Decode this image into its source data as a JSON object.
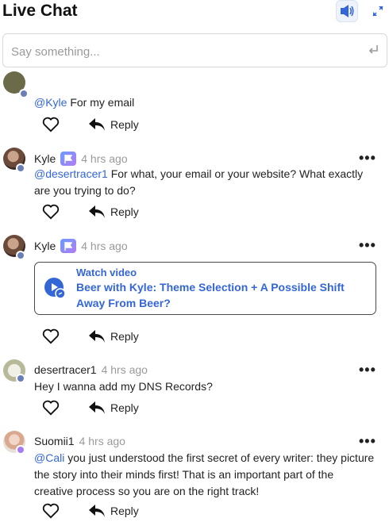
{
  "header": {
    "title": "Live Chat"
  },
  "input": {
    "placeholder": "Say something..."
  },
  "messages": [
    {
      "name": "",
      "time": "",
      "mention": "@Kyle",
      "text": " For my email",
      "reply": "Reply"
    },
    {
      "name": "Kyle",
      "time": "4 hrs ago",
      "mention": "@desertracer1",
      "text": " For what, your email or your website? What exactly are you trying to do?",
      "reply": "Reply"
    },
    {
      "name": "Kyle",
      "time": "4 hrs ago",
      "video_kicker": "Watch video",
      "video_title": "Beer with Kyle: Theme Selection + A Possible Shift Away From Beer?",
      "reply": "Reply"
    },
    {
      "name": "desertracer1",
      "time": "4 hrs ago",
      "text": "Hey I wanna add my DNS Records?",
      "reply": "Reply"
    },
    {
      "name": "Suomii1",
      "time": "4 hrs ago",
      "mention": "@Cali",
      "text": " you just understood the first secret of every writer: they picture the story into their minds first! That is an important part of the creative process so you are on the right track!",
      "reply": "Reply"
    }
  ],
  "colors": {
    "mention": "#3466d6",
    "accent": "#3466d6",
    "timestamp": "#9a9a9a"
  },
  "icons": [
    "sound-icon",
    "expand-icon",
    "enter-icon",
    "heart-icon",
    "reply-arrow-icon",
    "more-icon",
    "flag-icon",
    "play-icon"
  ]
}
